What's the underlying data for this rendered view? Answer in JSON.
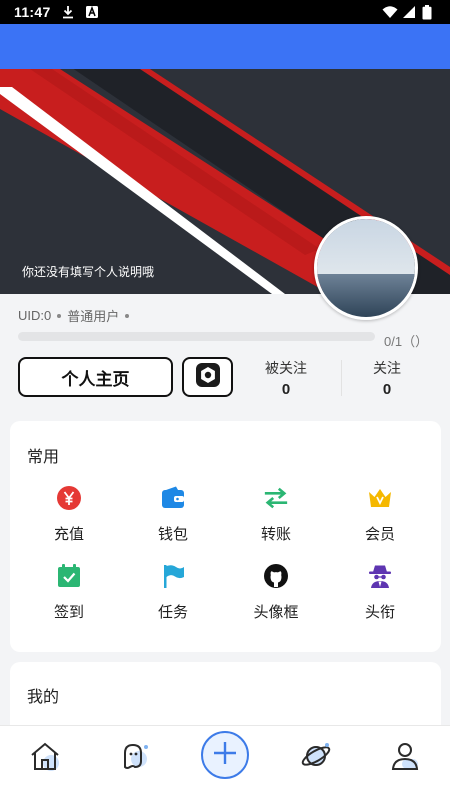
{
  "status_bar": {
    "time": "11:47",
    "left_icons": [
      "download-icon",
      "font-icon"
    ],
    "right_icons": [
      "wifi-icon",
      "signal-icon",
      "battery-icon"
    ]
  },
  "header": {
    "color": "#3b73f5"
  },
  "profile": {
    "bio": "你还没有填写个人说明哦",
    "uid": "UID:0",
    "role": "普通用户",
    "level_progress": 0,
    "progress_text": "0/1（）"
  },
  "actions": {
    "homepage_label": "个人主页",
    "settings_icon": "settings-icon"
  },
  "stats": {
    "followers_label": "被关注",
    "followers_value": "0",
    "following_label": "关注",
    "following_value": "0"
  },
  "common": {
    "title": "常用",
    "items": [
      {
        "label": "充值",
        "icon": "yen-icon",
        "color": "#e53935"
      },
      {
        "label": "钱包",
        "icon": "wallet-icon",
        "color": "#1e88e5"
      },
      {
        "label": "转账",
        "icon": "transfer-icon",
        "color": "#2bb673"
      },
      {
        "label": "会员",
        "icon": "vip-crown-icon",
        "color": "#f5b800"
      },
      {
        "label": "签到",
        "icon": "calendar-check-icon",
        "color": "#2bb673"
      },
      {
        "label": "任务",
        "icon": "flag-icon",
        "color": "#26a7d8"
      },
      {
        "label": "头像框",
        "icon": "github-icon",
        "color": "#111111"
      },
      {
        "label": "头衔",
        "icon": "spy-icon",
        "color": "#5e35b1"
      }
    ]
  },
  "mine": {
    "title": "我的"
  },
  "tab_bar": {
    "tabs": [
      {
        "icon": "home-icon"
      },
      {
        "icon": "ghost-chat-icon"
      },
      {
        "icon": "add-icon"
      },
      {
        "icon": "planet-icon"
      },
      {
        "icon": "user-icon"
      }
    ],
    "accent": "#3d7be8"
  }
}
